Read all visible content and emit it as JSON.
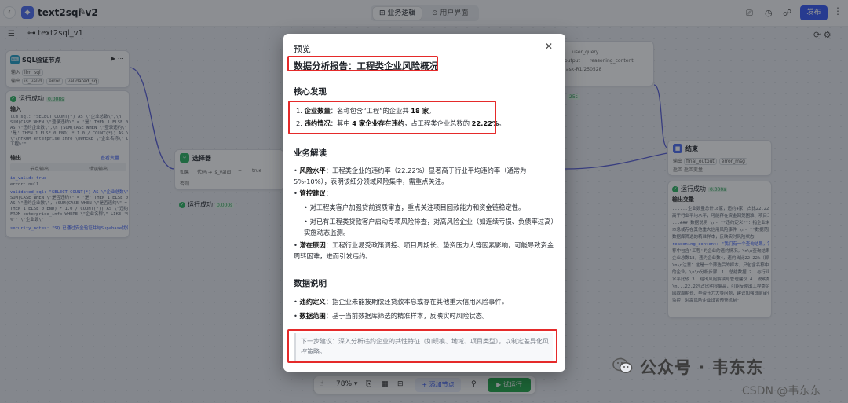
{
  "topbar": {
    "title": "text2sql-v2",
    "tab_business": "业务逻辑",
    "tab_ui": "用户界面",
    "publish": "发布"
  },
  "flow_tab": "text2sql_v1",
  "sql_node": {
    "title": "SQL验证节点",
    "input_label": "输入",
    "input_var": "llm_sql",
    "output_label": "输出",
    "outputs": [
      "is_valid",
      "error",
      "validated_sq"
    ],
    "run_status": "运行成功",
    "run_time": "0.008s",
    "input_section": "输入",
    "input_code": [
      "llm_sql: \"SELECT COUNT(*) AS \\\"企业总数\\\",\\n",
      "SUM(CASE WHEN \\\"登录违约\\\" = '是' THEN 1 ELSE 0 END)",
      "AS \\\"违约企业数\\\",\\n    (SUM(CASE WHEN \\\"登录违约\\\" =",
      "'是' THEN 1 ELSE 0 END) * 1.0 / COUNT(*)) AS \\\"违约占比",
      "\\\"\\nFROM enterprise_info \\nWHERE \\\"企业名称\\\" LIKE '%",
      "工程%'\""
    ],
    "output_section": "输出",
    "view_variables": "查看变量",
    "subtab_left": "节点输出",
    "subtab_right": "错误输出",
    "output_code": [
      "is_valid: true",
      "error: null",
      "validated_sql: \"SELECT COUNT(*) AS \\\"企业总数\\\",",
      "SUM(CASE WHEN \\\"是否违约\\\" = '是' THEN 1 ELSE 0 END)",
      "AS \\\"违约企业数\\\", (SUM(CASE WHEN \\\"是否违约\\\" = '是'",
      "THEN 1 ELSE 0 END) * 1.0 / COUNT(*)) AS \\\"违约占比\\\"",
      "FROM enterprise_info WHERE \\\"企业名称\\\" LIKE '%工程",
      "%'\"  \\\"企业数\\\"",
      "security_notes: \"SQL已通过安全验证并与Supabase优化\""
    ]
  },
  "selector_node": {
    "title": "选择器",
    "cond_label": "如果",
    "field": "代码 → is_valid",
    "op": "=",
    "value": "true",
    "else_label": "否则",
    "run_status": "运行成功",
    "run_time": "0.000s"
  },
  "top_right_node": {
    "lines": [
      "user_query",
      "output",
      "reasoning_content",
      "ask-R1/250528"
    ],
    "badge": "25s"
  },
  "end_node": {
    "title": "结束",
    "output_label": "输出",
    "outputs": [
      "final_output",
      "error_msg"
    ],
    "return_label": "返回",
    "return_value": "返回变量",
    "run_status": "运行成功",
    "run_time": "0.000s",
    "vars_label": "输出变量",
    "text_lines": [
      "......企业数量总计18家，违约4家，占比22.22%，",
      "高于行业平均水平，可能存在资金回笼困难、项目工期延误...",
      "...### 数据说明 \\n- **违约定义**：指企业未能按期偿还贷款",
      "本息或存在其他重大信用风险事件 \\n- **数据范围**：基于当前",
      "数据库筛选的精准样本，反映实时风险状态",
      "reasoning_content: \"我们有一个查询结果，需要分析企业名",
      "称中包含'工程'的企业的违约情况。\\n\\n查询结果：",
      "企业总数18，违约企业数4，违约占比22.22%（即0.2222...）",
      "\\n\\n注意：这是一个筛选后的样本，只包含名称中带有'工程'",
      "的企业。\\n\\n分析步骤：1. 总结数据 2. 与行业平均",
      "水平比较 3. 给出风险解读与管理建议 4. 说明数据来源",
      "\\n...22.22%占比明显偏高，可能反映出工程类企业普遍存在",
      "回款周期长、垫资压力大等问题，建议加强贷前审查与贷后",
      "监控，对高风险企业设置预警机制\""
    ]
  },
  "modal": {
    "title": "预览",
    "report_title": "数据分析报告：工程类企业风险概况",
    "sec1": "核心发现",
    "f1_label": "企业数量",
    "f1_pre": "：名称包含“工程”的企业共 ",
    "f1_num": "18 家",
    "f1_post": "。",
    "f2_label": "违约情况",
    "f2_pre": "：其中 ",
    "f2_bold": "4 家企业存在违约",
    "f2_mid": "，占工程类企业总数的 ",
    "f2_num": "22.22%",
    "f2_post": "。",
    "sec2": "业务解读",
    "b1_label": "风险水平",
    "b1_text": "：工程类企业的违约率（22.22%）显著高于行业平均违约率（通常为 5%-10%），表明该细分领域风险集中，需重点关注。",
    "b2_label": "管控建议",
    "b2_suffix": "：",
    "b2_sub1": "对工程类客户加强贷前资质审查，重点关注项目回款能力和资金链稳定性。",
    "b2_sub2": "对已有工程类贷款客户启动专项风险排查，对高风险企业（如连续亏损、负债率过高）实施动态监测。",
    "b3_label": "潜在原因",
    "b3_text": "：工程行业易受政策调控、项目周期长、垫资压力大等因素影响，可能导致资金周转困难，进而引发违约。",
    "sec3": "数据说明",
    "d1_label": "违约定义",
    "d1_text": "：指企业未能按期偿还贷款本息或存在其他重大信用风险事件。",
    "d2_label": "数据范围",
    "d2_text": "：基于当前数据库筛选的精准样本，反映实时风险状态。",
    "next_label": "下一步建议",
    "next_text": "：深入分析违约企业的共性特征（如规模、地域、项目类型），以制定差异化风控策略。"
  },
  "bottom_bar": {
    "zoom": "78%",
    "add_node": "添加节点",
    "run": "试运行"
  },
  "watermark": {
    "wechat": "公众号 · 韦东东",
    "csdn": "CSDN @韦东东"
  },
  "colors": {
    "accent": "#3a5cf5",
    "success": "#2fb463",
    "highlight_box": "#e52a2a"
  }
}
